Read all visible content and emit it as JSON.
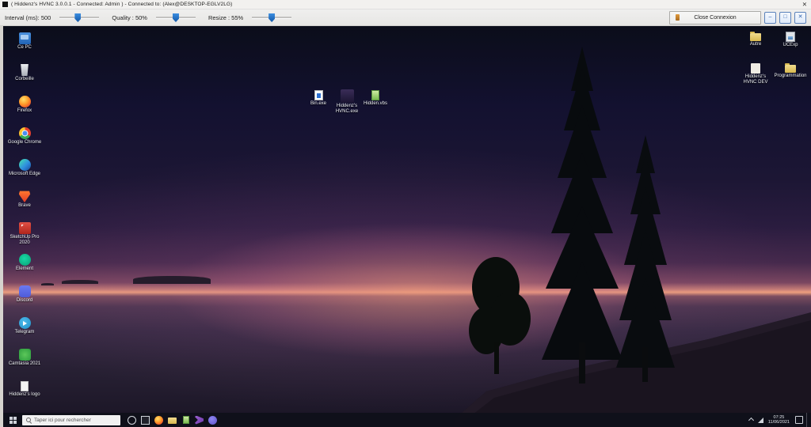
{
  "window": {
    "title": "( Hiddenz's HVNC 3.0.0.1 - Connected: Admin ) - Connected to: (Alex@DESKTOP-EGLV2LG)",
    "close_glyph": "✕"
  },
  "toolbar": {
    "sliders": [
      {
        "label": "Interval (ms): 500",
        "value": 500,
        "pct": 46
      },
      {
        "label": "Quality : 50%",
        "value": 50,
        "pct": 50
      },
      {
        "label": "Resize : 55%",
        "value": 55,
        "pct": 50
      }
    ],
    "close_connexion_label": "Close Connexion",
    "win_buttons": [
      {
        "glyph": "–",
        "name": "minimize"
      },
      {
        "glyph": "□",
        "name": "maximize"
      },
      {
        "glyph": "✕",
        "name": "close"
      }
    ]
  },
  "desktop": {
    "left_icons": [
      {
        "label": "Ce PC",
        "icon": "pc"
      },
      {
        "label": "Corbeille",
        "icon": "bin"
      },
      {
        "label": "Firefox",
        "icon": "firefox"
      },
      {
        "label": "Google Chrome",
        "icon": "chrome"
      },
      {
        "label": "Microsoft Edge",
        "icon": "edge"
      },
      {
        "label": "Brave",
        "icon": "brave"
      },
      {
        "label": "SketchUp Pro 2020",
        "icon": "sketchup"
      },
      {
        "label": "Element",
        "icon": "element"
      },
      {
        "label": "Discord",
        "icon": "discord"
      },
      {
        "label": "Telegram",
        "icon": "telegram"
      },
      {
        "label": "Camtasia 2021",
        "icon": "camtasia"
      },
      {
        "label": "Hiddenz's logo",
        "icon": "docwhite"
      }
    ],
    "center_icons": [
      {
        "label": "Bin.exe",
        "icon": "docblue"
      },
      {
        "label": "Hiddenz's HVNC.exe",
        "icon": "appdark"
      },
      {
        "label": "Hidden.vbs",
        "icon": "docgreen"
      }
    ],
    "right_icons": [
      {
        "label": "Autre",
        "icon": "folder"
      },
      {
        "label": "UCExp",
        "icon": "image"
      },
      {
        "label": "Hiddenz's HVNC DEV",
        "icon": "folderpale"
      },
      {
        "label": "Programmation",
        "icon": "folder"
      }
    ]
  },
  "taskbar": {
    "search_placeholder": "Taper ici pour rechercher",
    "app_icons": [
      {
        "name": "cortana-icon",
        "icon": "cortana"
      },
      {
        "name": "task-view-icon",
        "icon": "taskview"
      },
      {
        "name": "firefox-icon",
        "icon": "firefox2"
      },
      {
        "name": "file-explorer-icon",
        "icon": "folder2"
      },
      {
        "name": "green-doc-icon",
        "icon": "docgreen2"
      },
      {
        "name": "visual-studio-icon",
        "icon": "vs"
      },
      {
        "name": "purple-app-icon",
        "icon": "purple"
      }
    ],
    "tray": {
      "time": "07:25",
      "date": "11/06/2021"
    }
  },
  "colors": {
    "accent_blue": "#1f76d2",
    "sunset_glow": "#ee9f7e",
    "taskbar_bg": "#10111a",
    "folder_yellow": "#d8b94f"
  }
}
